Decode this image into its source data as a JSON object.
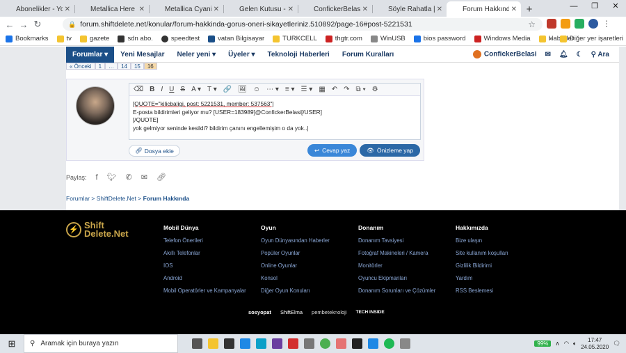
{
  "tabs": [
    {
      "label": "Abonelikler - YouT",
      "color": "#ff0000"
    },
    {
      "label": "Metallica Here Co",
      "color": "#ff0000"
    },
    {
      "label": "Metallica Cyanide",
      "color": "#ff0000"
    },
    {
      "label": "Gelen Kutusu - co",
      "color": "#d93025"
    },
    {
      "label": "ConfickerBelasi Ki",
      "color": "#c9a54a"
    },
    {
      "label": "Söyle Rahatla | Say",
      "color": "#c9a54a"
    },
    {
      "label": "Forum Hakkında |",
      "color": "#c9a54a"
    }
  ],
  "new_tab": "+",
  "window_controls": {
    "minimize": "—",
    "restore": "❐",
    "close": "✕"
  },
  "nav": {
    "back": "←",
    "forward": "→",
    "reload": "↻"
  },
  "address": {
    "url": "forum.shiftdelete.net/konular/forum-hakkinda-gorus-oneri-sikayetleriniz.510892/page-16#post-5221531",
    "lock": "🔒",
    "star": "☆"
  },
  "bookmarks": [
    {
      "label": "Bookmarks",
      "color": "#1a73e8"
    },
    {
      "label": "tv",
      "color": "#f4c430"
    },
    {
      "label": "gazete",
      "color": "#f4c430"
    },
    {
      "label": "sdn abo.",
      "color": "#333"
    },
    {
      "label": "speedtest",
      "color": "#333"
    },
    {
      "label": "vatan Bilgisayar",
      "color": "#1b4f88"
    },
    {
      "label": "TURKCELL",
      "color": "#f4c430"
    },
    {
      "label": "thgtr.com",
      "color": "#cc2222"
    },
    {
      "label": "WinUSB",
      "color": "#888"
    },
    {
      "label": "bios password",
      "color": "#1a73e8"
    },
    {
      "label": "Windows Media",
      "color": "#cc2222"
    },
    {
      "label": "Haberler",
      "color": "#f4c430"
    }
  ],
  "bookmarks_more": "»",
  "other_bookmarks": "Diğer yer işaretleri",
  "site_nav": {
    "items": [
      "Forumlar",
      "Yeni Mesajlar",
      "Neler yeni",
      "Üyeler",
      "Teknoloji Haberleri",
      "Forum Kuralları"
    ],
    "user": "ConfickerBelasi",
    "search": "Ara"
  },
  "pagination": [
    "« Önceki",
    "1",
    "…",
    "14",
    "15",
    "16"
  ],
  "editor": {
    "toolbar": [
      "⌫",
      "B",
      "I",
      "U",
      "S",
      "A ▾",
      "T ▾",
      "🔗",
      "🖼",
      "☺",
      "⋯ ▾",
      "≡ ▾",
      "☰ ▾",
      "▦",
      "↶",
      "↷",
      "⧉ ▾",
      "⚙"
    ],
    "lines": [
      "[QUOTE=\"kilicbaligi, post: 5221531, member: 537563\"]",
      "E-posta bildirimleri geliyor mu? [USER=183989]@ConfickerBelasi[/USER]",
      "[/QUOTE]",
      "yok gelmiyor seninde kesildi? bildirim çanını engellemişim o da yok..|"
    ],
    "attach": "Dosya ekle",
    "reply": "Cevap yaz",
    "preview": "Önizleme yap"
  },
  "share": {
    "label": "Paylaş:"
  },
  "breadcrumb": [
    "Forumlar",
    "ShiftDelete.Net",
    "Forum Hakkında"
  ],
  "footer": {
    "logo_line1": "Shift",
    "logo_line2": "Delete.Net",
    "columns": [
      {
        "title": "Mobil Dünya",
        "links": [
          "Telefon Önerileri",
          "Akıllı Telefonlar",
          "IOS",
          "Android",
          "Mobil Operatörler ve Kampanyalar"
        ]
      },
      {
        "title": "Oyun",
        "links": [
          "Oyun Dünyasından Haberler",
          "Popüler Oyunlar",
          "Online Oyunlar",
          "Konsol",
          "Diğer Oyun Konuları"
        ]
      },
      {
        "title": "Donanım",
        "links": [
          "Donanım Tavsiyesi",
          "Fotoğraf Makineleri / Kamera",
          "Monitörler",
          "Oyuncu Ekipmanları",
          "Donanım Sorunları ve Çözümler"
        ]
      },
      {
        "title": "Hakkımızda",
        "links": [
          "Bize ulaşın",
          "Site kullanım koşulları",
          "Gizlilik Bildirimi",
          "Yardım",
          "RSS Beslemesi"
        ]
      }
    ],
    "partners": [
      "sosyopat",
      "ShiftElma",
      "pembeteknoloji",
      "TECH INSIDE"
    ]
  },
  "taskbar": {
    "search_placeholder": "Aramak için buraya yazın",
    "battery": "99%",
    "time": "17:47",
    "date": "24.05.2020"
  }
}
